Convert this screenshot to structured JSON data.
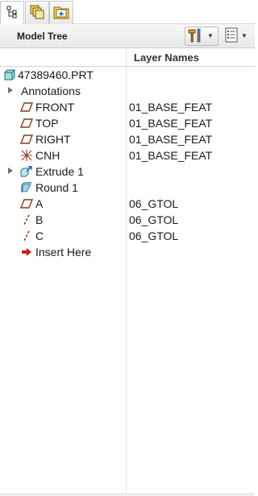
{
  "tabs": [
    {
      "icon": "model-tree-icon",
      "active": true
    },
    {
      "icon": "layers-icon",
      "active": false
    },
    {
      "icon": "favorites-folder-icon",
      "active": false
    }
  ],
  "panel": {
    "title": "Model Tree"
  },
  "columns": {
    "layer_names": "Layer Names"
  },
  "tree": {
    "root": "47389460.PRT",
    "annotations": "Annotations",
    "front": "FRONT",
    "front_layer": "01_BASE_FEAT",
    "top": "TOP",
    "top_layer": "01_BASE_FEAT",
    "right": "RIGHT",
    "right_layer": "01_BASE_FEAT",
    "cnh": "CNH",
    "cnh_layer": "01_BASE_FEAT",
    "extrude": "Extrude 1",
    "round": "Round 1",
    "a": "A",
    "a_layer": "06_GTOL",
    "b": "B",
    "b_layer": "06_GTOL",
    "c": "C",
    "c_layer": "06_GTOL",
    "insert": "Insert Here"
  },
  "colors": {
    "datum_plane": "#8b3a1a",
    "part": "#2a9d9d",
    "insert_arrow": "#d41a1a"
  }
}
